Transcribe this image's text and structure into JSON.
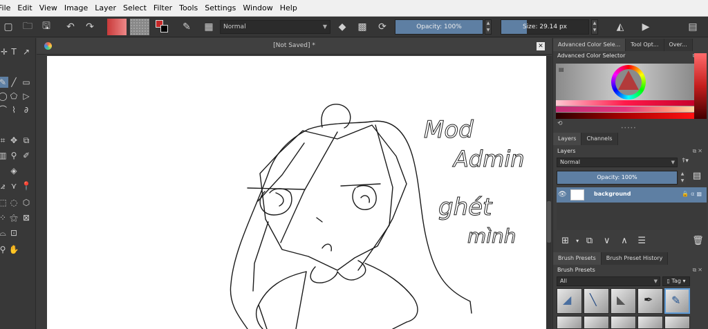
{
  "menu": [
    "File",
    "Edit",
    "View",
    "Image",
    "Layer",
    "Select",
    "Filter",
    "Tools",
    "Settings",
    "Window",
    "Help"
  ],
  "toolbar": {
    "blend_mode": "Normal",
    "opacity_label": "Opacity: 100%",
    "opacity_value": 1.0,
    "size_label": "Size: 29.14 px",
    "size_fraction": 0.29,
    "foreground_color": "#c62828",
    "background_color": "#000000"
  },
  "document": {
    "title": "[Not Saved]  *",
    "close_label": "✕"
  },
  "artwork_text": [
    "Mod",
    "Admin",
    "ghét",
    "mình"
  ],
  "dock": {
    "top_tabs": [
      "Advanced Color Sele...",
      "Tool Opt...",
      "Over..."
    ],
    "color_selector_title": "Advanced Color Selector",
    "layer_tabs": [
      "Layers",
      "Channels"
    ],
    "layers_title": "Layers",
    "layer_blend_mode": "Normal",
    "layer_opacity_label": "Opacity:  100%",
    "layers": [
      {
        "name": "background",
        "visible": true
      }
    ],
    "preset_tabs": [
      "Brush Presets",
      "Brush Preset History"
    ],
    "presets_title": "Brush Presets",
    "preset_filter": "All",
    "tag_label": "Tag"
  },
  "colors": {
    "accent": "#5e7fa3",
    "menubar": "#f0f0f0",
    "panel": "#3d3d3d"
  }
}
